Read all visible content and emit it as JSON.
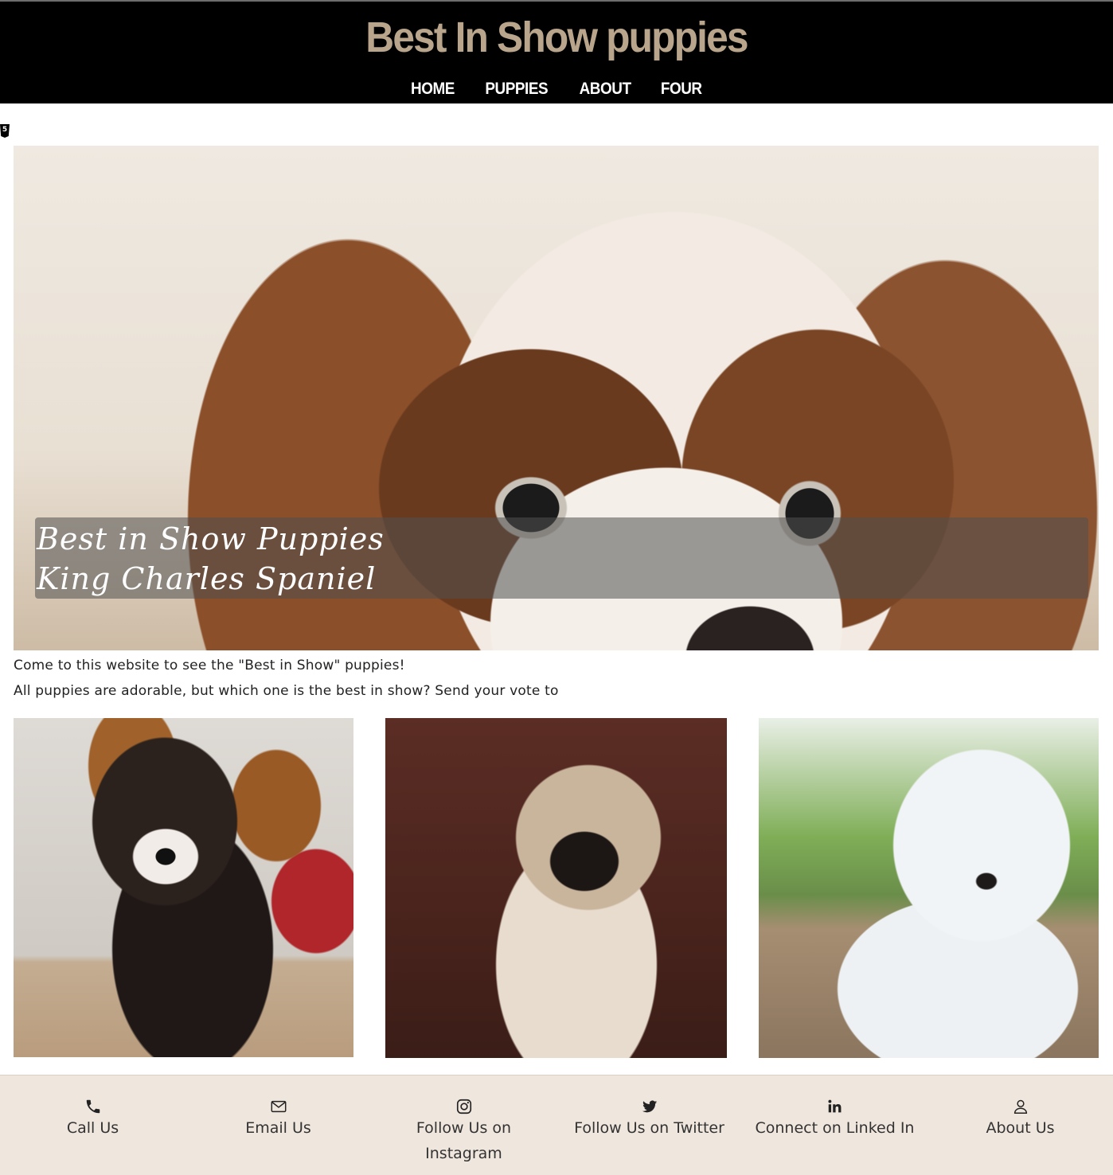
{
  "header": {
    "title": "Best In Show puppies",
    "nav": [
      "HOME",
      "PUPPIES",
      "ABOUT",
      "FOUR"
    ]
  },
  "hero": {
    "caption_line1": "Best in Show Puppies",
    "caption_line2": "King Charles Spaniel"
  },
  "intro": {
    "line1": "Come to this website to see the \"Best in Show\" puppies!",
    "line2": "All puppies are adorable, but which one is the best in show? Send your vote to"
  },
  "gallery": {
    "images": [
      "corgi puppy",
      "pug puppy",
      "white labrador puppy"
    ]
  },
  "footer": {
    "items": [
      {
        "label": "Call Us",
        "icon": "phone-icon"
      },
      {
        "label": "Email Us",
        "icon": "envelope-icon"
      },
      {
        "label": "Follow Us on Instagram",
        "icon": "instagram-icon"
      },
      {
        "label": "Follow Us on Twitter",
        "icon": "twitter-icon"
      },
      {
        "label": "Connect on Linked In",
        "icon": "linkedin-icon"
      },
      {
        "label": "About Us",
        "icon": "user-icon"
      }
    ]
  },
  "colors": {
    "header_bg": "#000000",
    "title_color": "#b8a58c",
    "footer_bg": "#efe6dd"
  }
}
